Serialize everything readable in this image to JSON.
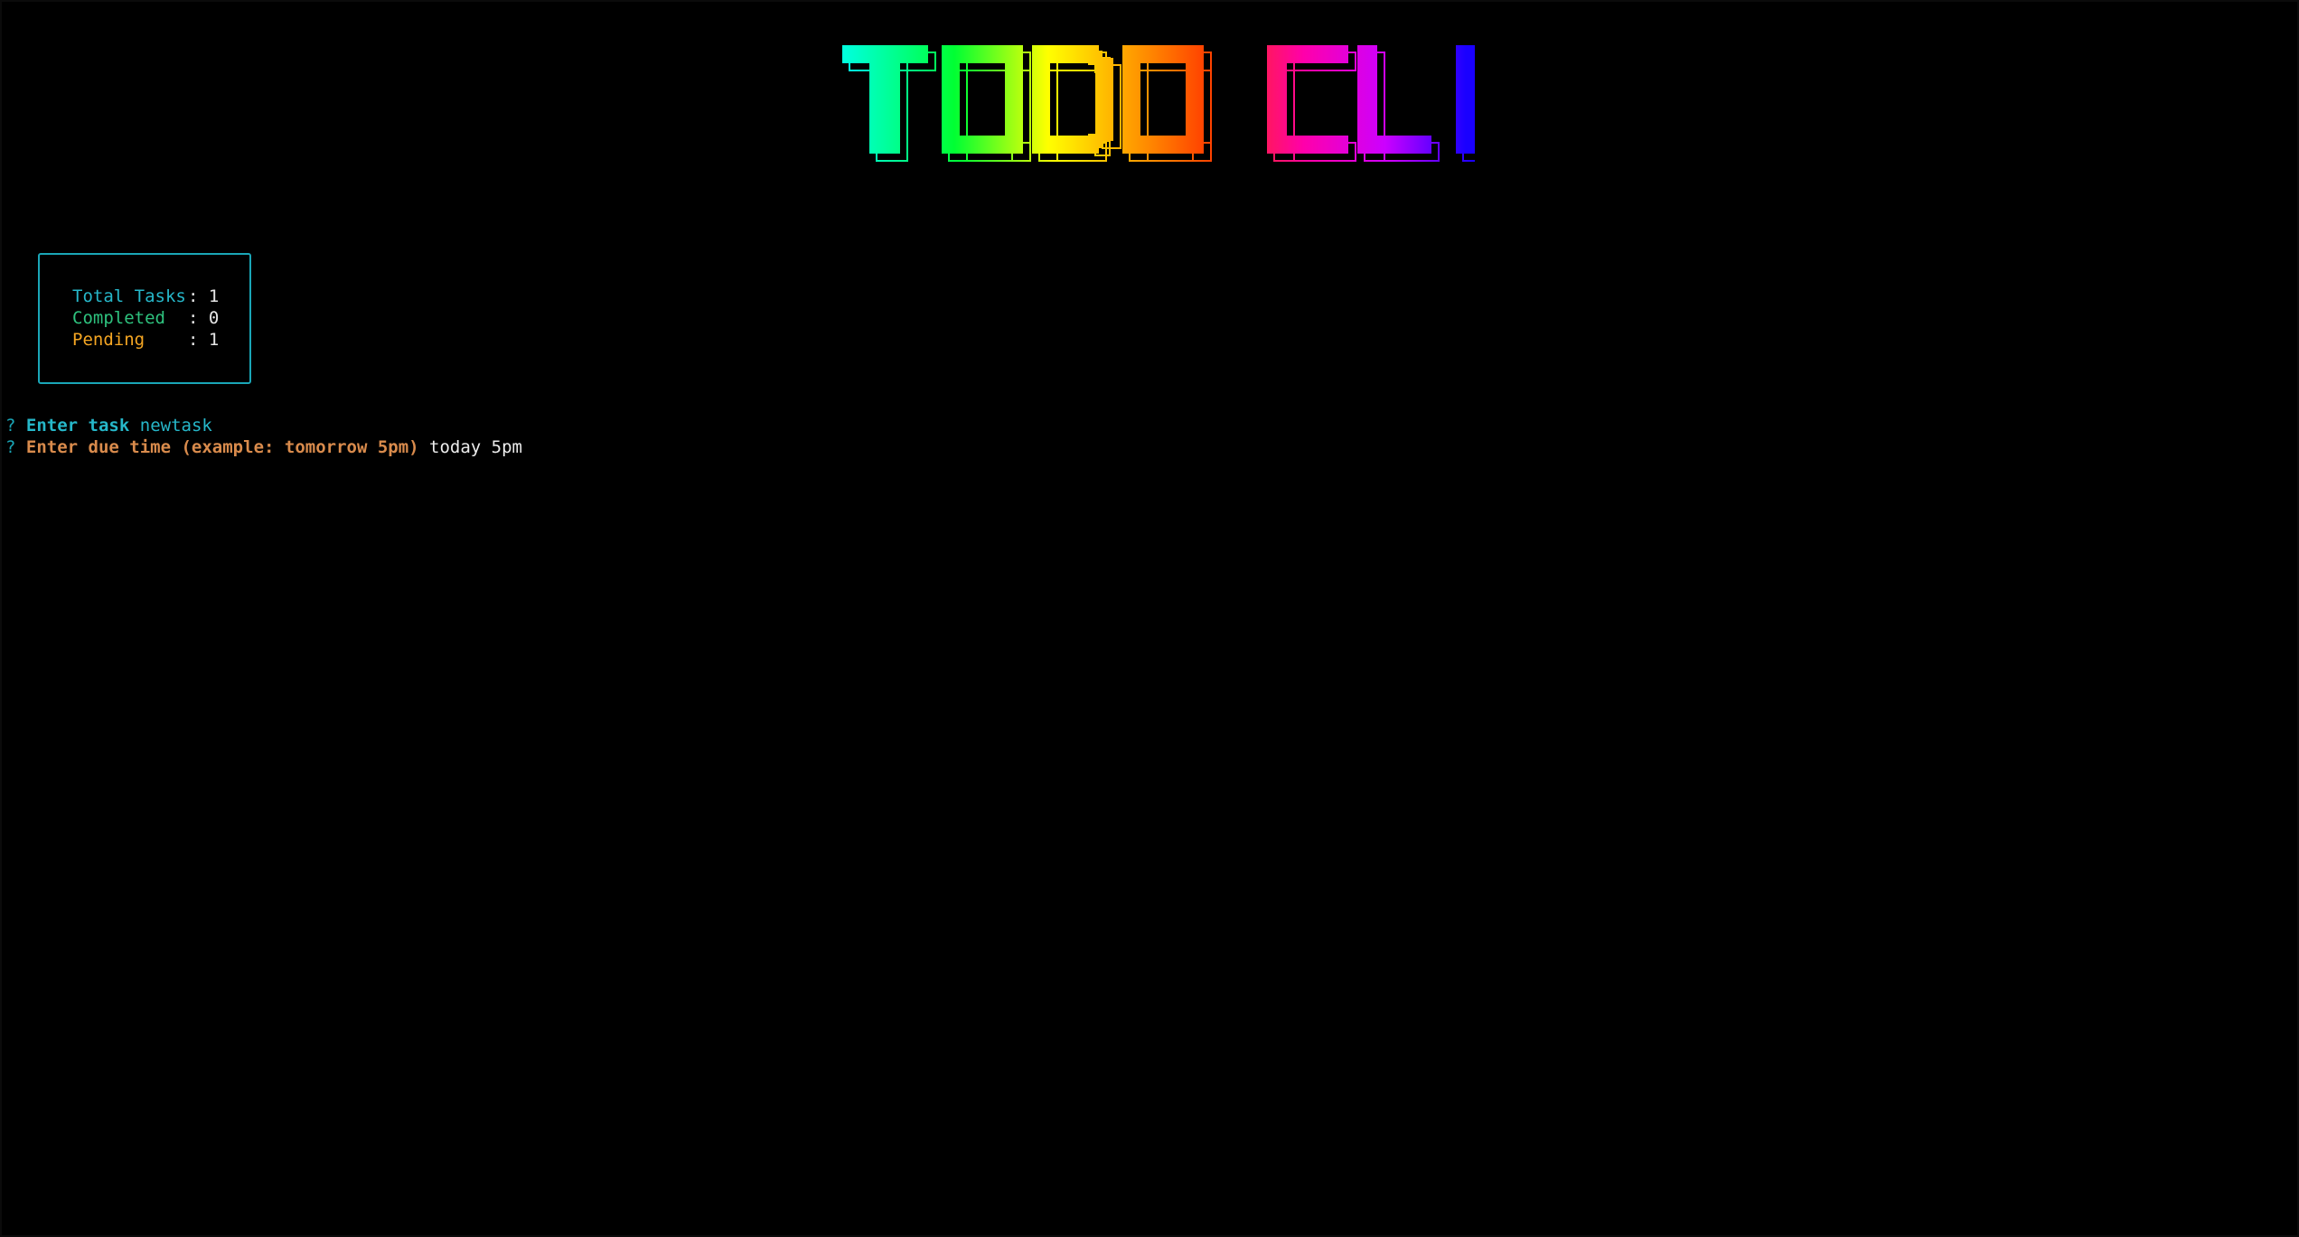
{
  "banner": {
    "title": "TODO CLI",
    "letters": [
      "T",
      "O",
      "D",
      "O",
      "C",
      "L",
      "I"
    ],
    "gradient": [
      "#00ffe0",
      "#00ff33",
      "#ffff00",
      "#ff9900",
      "#ff3300",
      "#ff00aa",
      "#cc00ff",
      "#1a00ff"
    ]
  },
  "stats": {
    "border_color": "#1aa6b7",
    "total": {
      "label": "Total Tasks",
      "value": "1",
      "color": "#26b7c9"
    },
    "completed": {
      "label": "Completed",
      "value": "0",
      "color": "#2ec27e"
    },
    "pending": {
      "label": "Pending",
      "value": "1",
      "color": "#f5a623"
    },
    "separator": ":"
  },
  "prompts": {
    "marker": "?",
    "task_question": "Enter task",
    "task_answer": "newtask",
    "due_question": "Enter due time (example: tomorrow 5pm)",
    "due_answer": "today 5pm"
  }
}
